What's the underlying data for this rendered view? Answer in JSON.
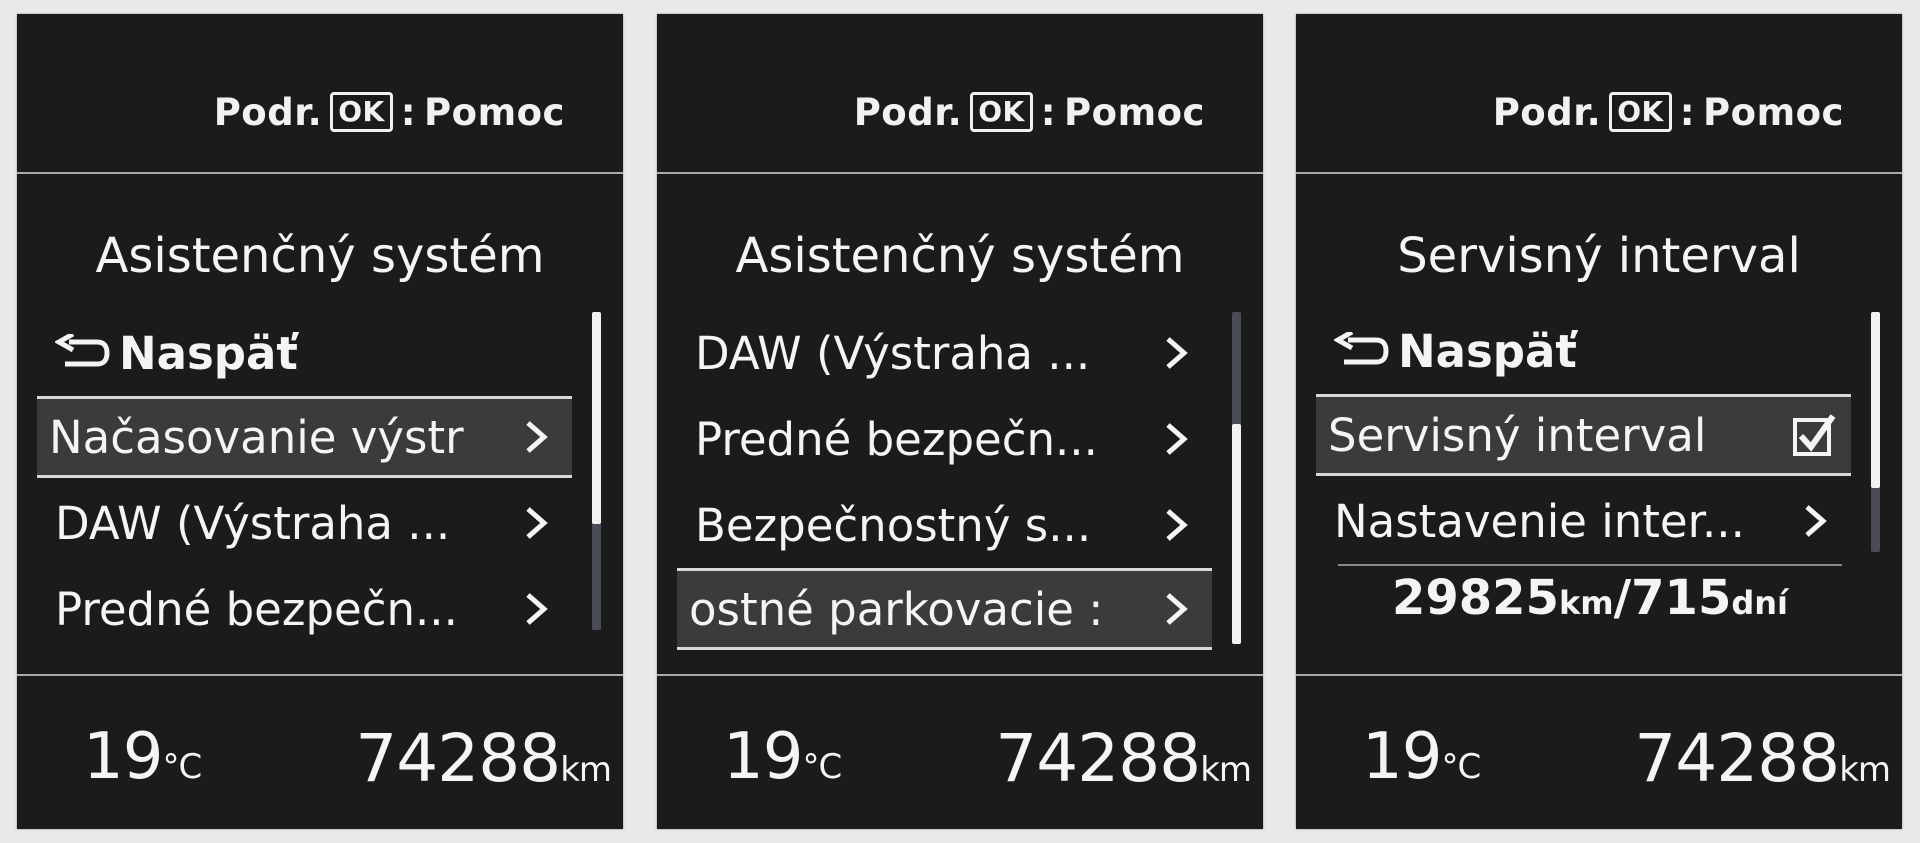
{
  "header": {
    "prefix": "Podr.",
    "ok_key": "OK",
    "separator": ":",
    "action": "Pomoc"
  },
  "footer": {
    "temperature": "19",
    "temperature_unit": "°C",
    "odometer": "74288",
    "odometer_unit": "km"
  },
  "screens": [
    {
      "title": "Asistenčný systém",
      "items": [
        {
          "label": "Naspäť",
          "icon": "back-arrow-icon"
        },
        {
          "label": "Načasovanie výstr",
          "icon": "chevron-right-icon",
          "selected": true
        },
        {
          "label": "DAW (Výstraha ...",
          "icon": "chevron-right-icon"
        },
        {
          "label": "Predné bezpečn...",
          "icon": "chevron-right-icon"
        }
      ],
      "scroll_position": 0.0
    },
    {
      "title": "Asistenčný systém",
      "items": [
        {
          "label": "DAW (Výstraha ...",
          "icon": "chevron-right-icon"
        },
        {
          "label": "Predné bezpečn...",
          "icon": "chevron-right-icon"
        },
        {
          "label": "Bezpečnostný s...",
          "icon": "chevron-right-icon"
        },
        {
          "label": "ostné parkovacie :",
          "icon": "chevron-right-icon",
          "selected": true
        }
      ],
      "scroll_position": 1.0
    },
    {
      "title": "Servisný interval",
      "items": [
        {
          "label": "Naspäť",
          "icon": "back-arrow-icon"
        },
        {
          "label": "Servisný interval",
          "icon": "checkbox-checked-icon",
          "selected": true,
          "checked": true
        },
        {
          "label": "Nastavenie inter...",
          "icon": "chevron-right-icon"
        }
      ],
      "info": {
        "distance": "29825",
        "distance_unit": "km",
        "separator": "/",
        "days": "715",
        "days_unit": "dní"
      },
      "scroll_position": 0.0
    }
  ]
}
